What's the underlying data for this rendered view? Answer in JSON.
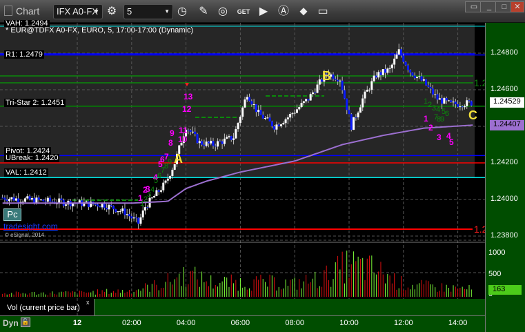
{
  "window": {
    "title": "Chart",
    "symbol": "IFX A0-FX",
    "interval": "5"
  },
  "toolbar": {
    "icons": [
      "settings-icon",
      "clock-icon",
      "pencil-icon",
      "chart-icon",
      "get-icon",
      "play-icon",
      "alert-icon",
      "link-icon",
      "comment-icon"
    ]
  },
  "chart": {
    "header_vah": "VAH: 1.2494",
    "description": "* EUR@TDFX A0-FX, EURO, 5, 17:00-17:00 (Dynamic)",
    "levels": [
      {
        "label": "R1: 1.2479",
        "price": 1.2479,
        "color": "#0000ff"
      },
      {
        "label": "Tri-Star 2: 1.2451",
        "price": 1.2451,
        "color": "#008800"
      },
      {
        "label": "Pivot: 1.2424",
        "price": 1.2424,
        "color": "#0000ff"
      },
      {
        "label": "UBreak: 1.2420",
        "price": 1.242,
        "color": "#ff0000"
      },
      {
        "label": "VAL: 1.2412",
        "price": 1.2412,
        "color": "#00e5e5"
      }
    ],
    "letters": [
      "A",
      "B",
      "C"
    ],
    "counts": [
      "1",
      "2",
      "3",
      "4",
      "5",
      "6",
      "7",
      "8",
      "9",
      "10",
      "11",
      "12",
      "13",
      "1",
      "2",
      "3",
      "4",
      "5"
    ],
    "green_counts": [
      "1",
      "2",
      "3",
      "4",
      "5",
      "6",
      "7",
      "8",
      "9",
      "1",
      "2",
      "3",
      "4",
      "5",
      "6",
      "7",
      "8",
      "9"
    ],
    "branding": "tradesight.com",
    "badge": "Pc",
    "copyright": "© eSignal, 2014",
    "price_axis": [
      "1.24800",
      "1.24600",
      "1.24200",
      "1.24000",
      "1.23800"
    ],
    "last_price": "1.24529",
    "vwap_price": "1.24407",
    "edge_labels": [
      "1.2",
      "1.2"
    ],
    "colors": {
      "up": "#ffffff",
      "down": "#0a1aff",
      "vwap": "#9c6fd0",
      "count": "#ff00ff",
      "letter": "#f2e03a"
    }
  },
  "chart_data": {
    "type": "candlestick",
    "x_ticks": [
      "12",
      "02:00",
      "04:00",
      "06:00",
      "08:00",
      "10:00",
      "12:00",
      "14:00"
    ],
    "close_path": [
      [
        "21:15",
        1.2401
      ],
      [
        "22:00",
        1.24
      ],
      [
        "23:00",
        1.2399
      ],
      [
        "00:00",
        1.2398
      ],
      [
        "01:00",
        1.2397
      ],
      [
        "01:45",
        1.2393
      ],
      [
        "02:15",
        1.2387
      ],
      [
        "02:30",
        1.2396
      ],
      [
        "03:15",
        1.2409
      ],
      [
        "03:35",
        1.242
      ],
      [
        "04:00",
        1.244
      ],
      [
        "04:30",
        1.2431
      ],
      [
        "05:00",
        1.243
      ],
      [
        "05:45",
        1.2434
      ],
      [
        "06:15",
        1.2458
      ],
      [
        "06:40",
        1.2447
      ],
      [
        "07:15",
        1.244
      ],
      [
        "07:45",
        1.2445
      ],
      [
        "08:30",
        1.2455
      ],
      [
        "09:10",
        1.2469
      ],
      [
        "09:40",
        1.2466
      ],
      [
        "10:05",
        1.244
      ],
      [
        "10:30",
        1.2455
      ],
      [
        "11:00",
        1.2468
      ],
      [
        "11:30",
        1.2471
      ],
      [
        "11:50",
        1.2481
      ],
      [
        "12:15",
        1.247
      ],
      [
        "12:45",
        1.2464
      ],
      [
        "13:15",
        1.2455
      ],
      [
        "13:45",
        1.2452
      ],
      [
        "14:35",
        1.24529
      ]
    ],
    "vwap_path": [
      [
        "21:15",
        1.2398
      ],
      [
        "02:00",
        1.2398
      ],
      [
        "03:20",
        1.2399
      ],
      [
        "04:00",
        1.2406
      ],
      [
        "04:45",
        1.241
      ],
      [
        "06:00",
        1.2415
      ],
      [
        "08:00",
        1.2421
      ],
      [
        "09:45",
        1.243
      ],
      [
        "11:15",
        1.2435
      ],
      [
        "12:45",
        1.2439
      ],
      [
        "14:35",
        1.24407
      ]
    ],
    "volume": {
      "label": "Vol (current price bar)",
      "ticks": [
        "1000",
        "500",
        "0"
      ],
      "current": "163",
      "hourly_level": [
        [
          "21:15",
          80
        ],
        [
          "00:00",
          100
        ],
        [
          "02:00",
          150
        ],
        [
          "03:00",
          300
        ],
        [
          "04:00",
          550
        ],
        [
          "05:00",
          350
        ],
        [
          "07:00",
          350
        ],
        [
          "08:00",
          320
        ],
        [
          "09:00",
          450
        ],
        [
          "10:00",
          800
        ],
        [
          "11:00",
          650
        ],
        [
          "12:00",
          300
        ],
        [
          "13:00",
          250
        ],
        [
          "14:35",
          180
        ]
      ]
    }
  },
  "status": {
    "mode": "Dyn"
  }
}
